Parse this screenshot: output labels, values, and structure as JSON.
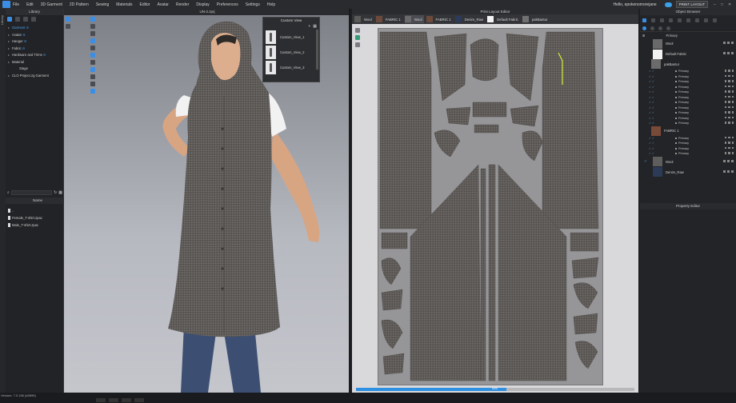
{
  "menu": [
    "File",
    "Edit",
    "3D Garment",
    "2D Pattern",
    "Sewing",
    "Materials",
    "Editor",
    "Avatar",
    "Render",
    "Display",
    "Preferences",
    "Settings",
    "Help"
  ],
  "user": "Hello, epokenomorejane",
  "mode_label": "PRINT LAYOUT",
  "left_strip_label": "Library",
  "library": {
    "title": "Library",
    "tree": [
      {
        "label": "Garment",
        "level": 0,
        "selected": true
      },
      {
        "label": "Avatar",
        "level": 0
      },
      {
        "label": "Hanger",
        "level": 0
      },
      {
        "label": "Fabric",
        "level": 0
      },
      {
        "label": "Hardware and Trims",
        "level": 0
      },
      {
        "label": "Material",
        "level": 0
      },
      {
        "label": "Stage",
        "level": 1
      },
      {
        "label": "CLO Project.zg Garment",
        "level": 0
      }
    ],
    "list_header": "Name",
    "files": [
      "..",
      "Female_T-shirt.zpac",
      "Male_T-shirt.zpac"
    ]
  },
  "view3d": {
    "title": "UN-2.zprj"
  },
  "custom_view": {
    "title": "Custom View",
    "items": [
      "Custom_View_1",
      "Custom_View_2",
      "Custom_View_3"
    ]
  },
  "print_layout": {
    "title": "Print Layout Editor",
    "fabrics": [
      {
        "label": "Wool",
        "color": "#5b5a59"
      },
      {
        "label": "FABRIC 1",
        "color": "#6e4a3b"
      },
      {
        "label": "Wool",
        "color": "#6a6a6c",
        "active": true
      },
      {
        "label": "FABRIC 1",
        "color": "#6e4a3b"
      },
      {
        "label": "Denim_Raw",
        "color": "#2d3a5a"
      },
      {
        "label": "Default Fabric",
        "color": "#f4f4f4"
      },
      {
        "label": "pakBantur",
        "color": "#707070"
      }
    ],
    "progress_pct": 54,
    "progress_label": "54%",
    "canvas_color": "#969598",
    "piece_color": "#5f5b58"
  },
  "object_browser": {
    "title": "Object Browser",
    "sub": "Primary",
    "rows": [
      {
        "type": "item",
        "label": "Wool",
        "color": "#6a6a6a"
      },
      {
        "type": "item",
        "label": "Default Fabric",
        "color": "#f2f2f2"
      },
      {
        "type": "group",
        "label": "pakBantur",
        "color": "#6b6b6b",
        "children": [
          "Primary",
          "Primary",
          "Primary",
          "Primary",
          "Primary",
          "Primary",
          "Primary",
          "Primary",
          "Primary",
          "Primary",
          "Primary"
        ]
      },
      {
        "type": "group",
        "label": "FABRIC 1",
        "color": "#7a4a38",
        "children": [
          "Primary",
          "Primary",
          "Primary",
          "Primary"
        ]
      },
      {
        "type": "item",
        "label": "Wool",
        "color": "#5e5e5e",
        "checked": true
      },
      {
        "type": "item",
        "label": "Denim_Raw",
        "color": "#2c3a58"
      }
    ],
    "property_title": "Property Editor"
  },
  "status": {
    "version": "Version: 7.0.156 (#0896)"
  }
}
